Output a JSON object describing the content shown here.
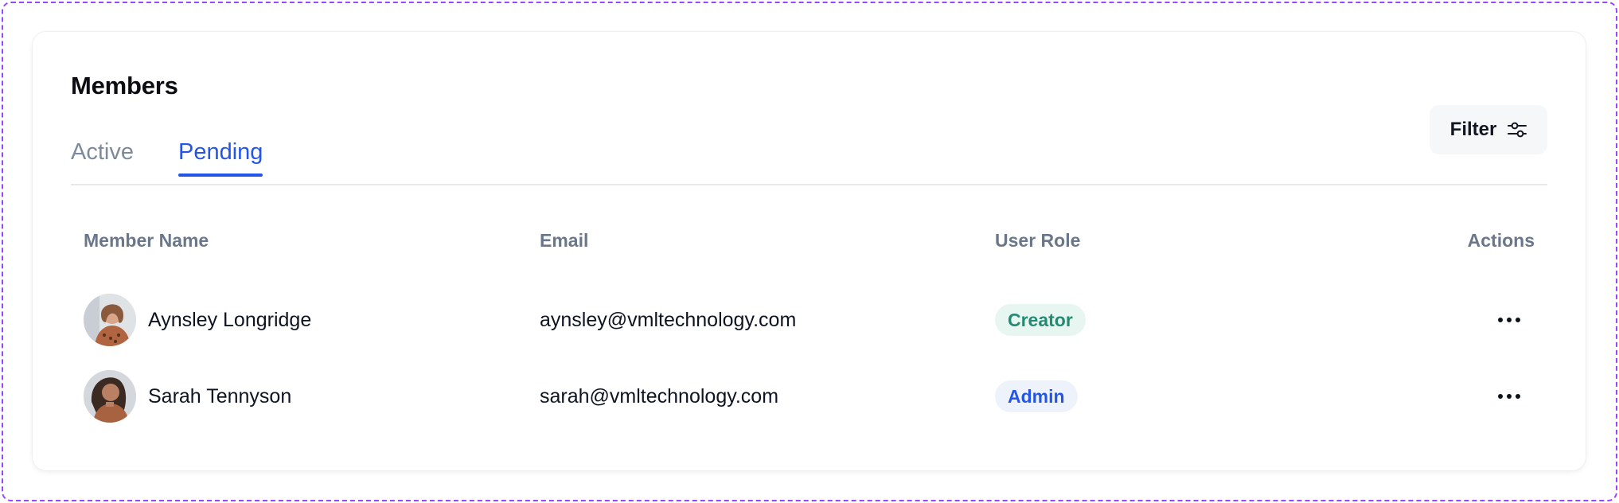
{
  "card": {
    "title": "Members",
    "tabs": [
      {
        "label": "Active",
        "active": false
      },
      {
        "label": "Pending",
        "active": true
      }
    ],
    "filter_label": "Filter",
    "filter_icon": "sliders-icon"
  },
  "table": {
    "headers": {
      "name": "Member Name",
      "email": "Email",
      "role": "User Role",
      "actions": "Actions"
    },
    "rows": [
      {
        "name": "Aynsley Longridge",
        "email": "aynsley@vmltechnology.com",
        "role": "Creator",
        "role_type": "creator",
        "actions_icon": "more-horizontal-icon"
      },
      {
        "name": "Sarah Tennyson",
        "email": "sarah@vmltechnology.com",
        "role": "Admin",
        "role_type": "admin",
        "actions_icon": "more-horizontal-icon"
      }
    ]
  },
  "colors": {
    "accent": "#2356e6",
    "creator_badge_bg": "#e7f6f1",
    "creator_badge_text": "#258a72",
    "admin_badge_bg": "#eef2fa",
    "admin_badge_text": "#2356e6",
    "frame_dashed": "#9747ff"
  }
}
